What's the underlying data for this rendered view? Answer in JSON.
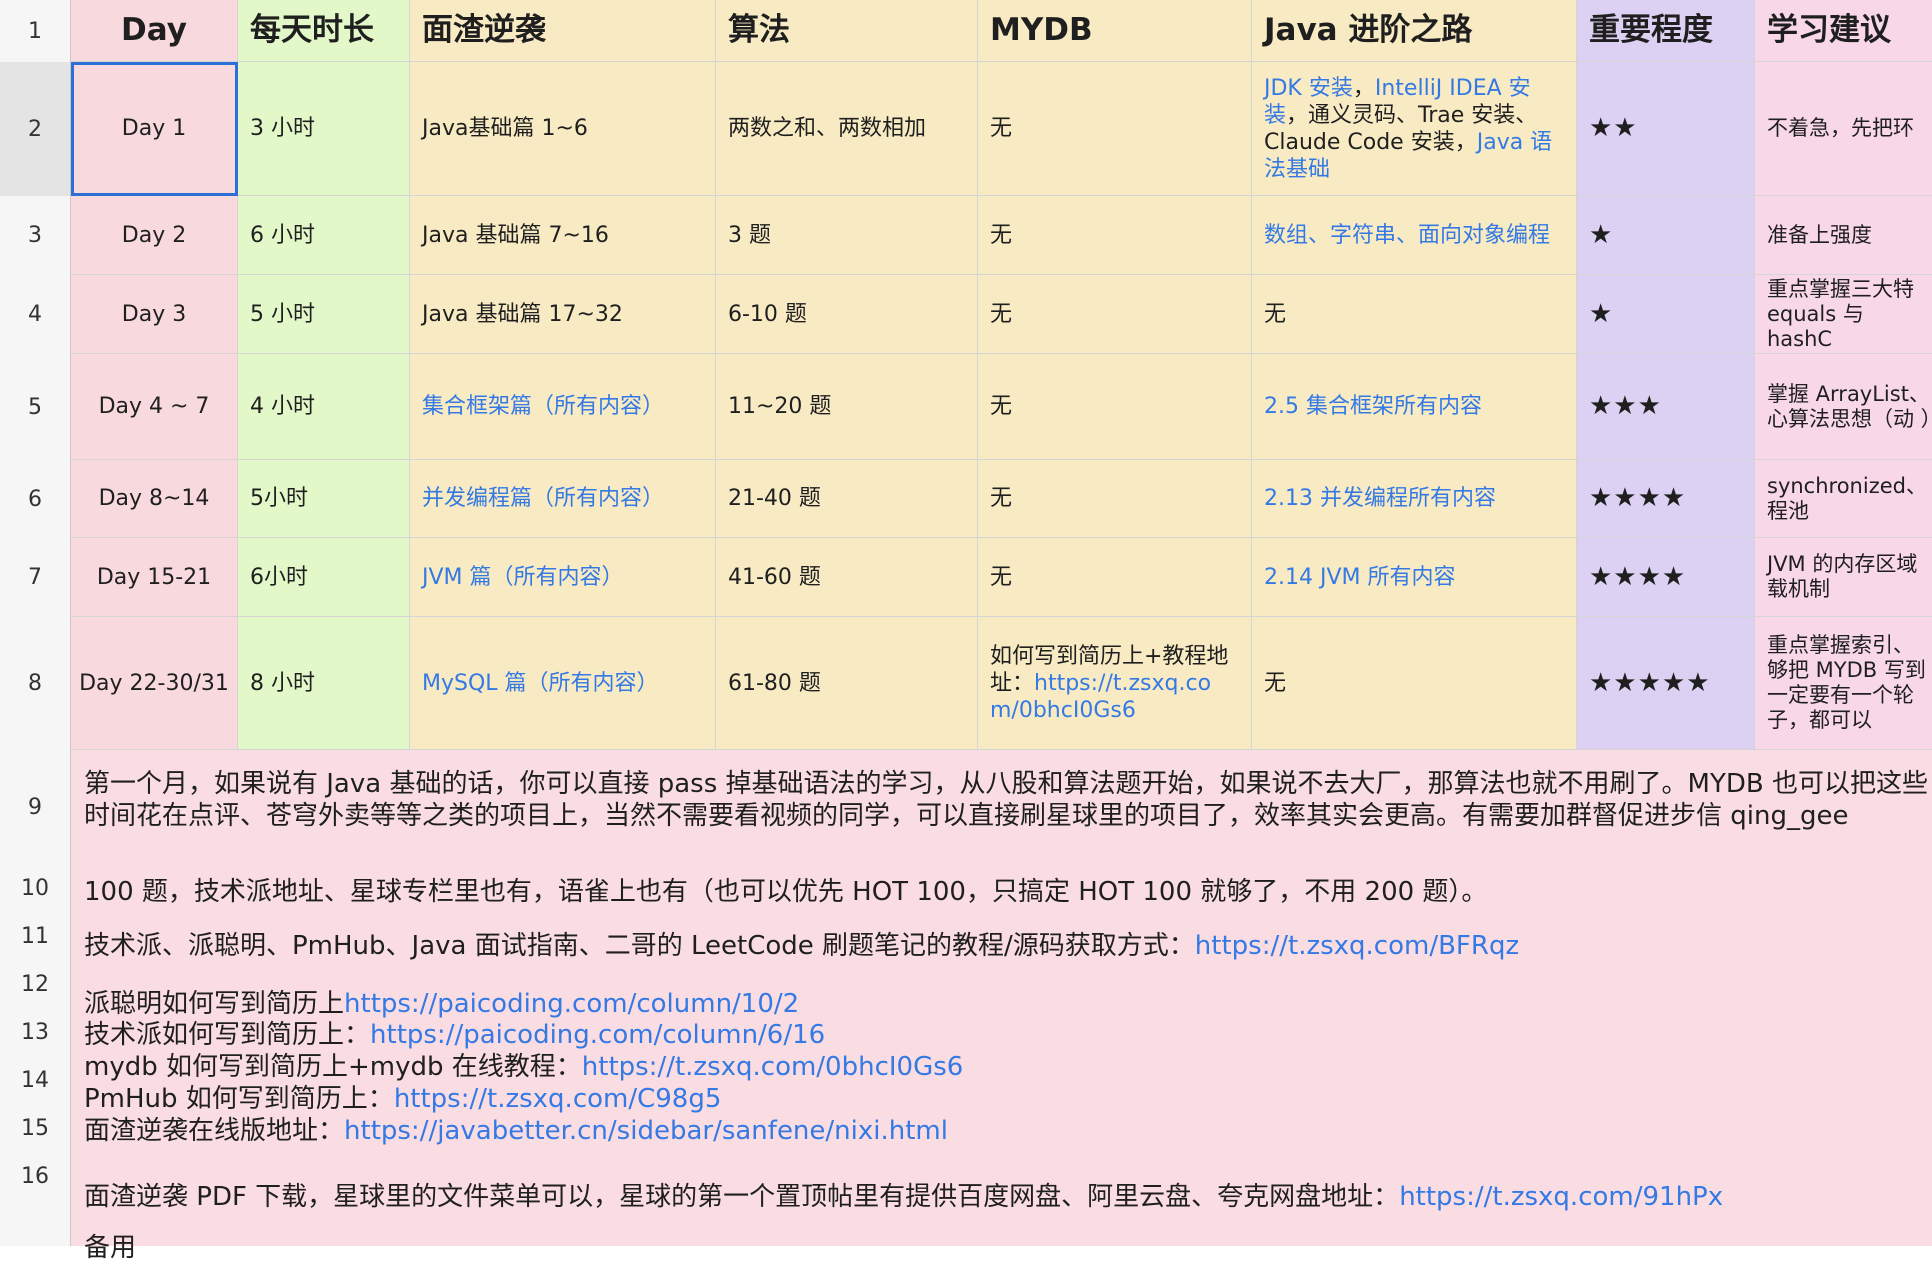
{
  "row_numbers": [
    "1",
    "2",
    "3",
    "4",
    "5",
    "6",
    "7",
    "8",
    "9",
    "10",
    "11",
    "12",
    "13",
    "14",
    "15",
    "16"
  ],
  "headers": [
    "Day",
    "每天时长",
    "面渣逆袭",
    "算法",
    "MYDB",
    "Java 进阶之路",
    "重要程度",
    "学习建议"
  ],
  "rows": [
    {
      "day": "Day 1",
      "hours": "3 小时",
      "mianzha": "Java基础篇 1~6",
      "algo": "两数之和、两数相加",
      "mydb": "无",
      "java_parts": [
        {
          "t": "JDK 安装",
          "link": true
        },
        {
          "t": "，",
          "link": false
        },
        {
          "t": "IntelliJ IDEA 安装",
          "link": true
        },
        {
          "t": "，通义灵码、Trae 安装、Claude Code 安装，",
          "link": false
        },
        {
          "t": "Java 语法基础",
          "link": true
        }
      ],
      "stars": "★★",
      "advice": "不着急，先把环"
    },
    {
      "day": "Day 2",
      "hours": "6 小时",
      "mianzha": "Java 基础篇 7~16",
      "algo": "3 题",
      "mydb": "无",
      "java_parts": [
        {
          "t": "数组、字符串、面向对象编程",
          "link": true
        }
      ],
      "stars": "★",
      "advice": "准备上强度"
    },
    {
      "day": "Day 3",
      "hours": "5 小时",
      "mianzha": "Java 基础篇 17~32",
      "algo": "6-10 题",
      "mydb": "无",
      "java_parts": [
        {
          "t": "无",
          "link": false
        }
      ],
      "stars": "★",
      "advice": "重点掌握三大特 equals 与 hashC"
    },
    {
      "day": "Day 4 ~ 7",
      "hours": "4 小时",
      "mianzha": "集合框架篇（所有内容）",
      "mianzha_link": true,
      "algo": "11~20 题",
      "mydb": "无",
      "java_parts": [
        {
          "t": "2.5 集合框架所有内容",
          "link": true
        }
      ],
      "stars": "★★★",
      "advice": "掌握 ArrayList、心算法思想（动 ）"
    },
    {
      "day": "Day 8~14",
      "hours": "5小时",
      "mianzha": "并发编程篇（所有内容）",
      "mianzha_link": true,
      "algo": "21-40 题",
      "mydb": "无",
      "java_parts": [
        {
          "t": "2.13 并发编程所有内容",
          "link": true
        }
      ],
      "stars": "★★★★",
      "advice": "synchronized、程池"
    },
    {
      "day": "Day 15-21",
      "hours": "6小时",
      "mianzha": "JVM 篇（所有内容）",
      "mianzha_link": true,
      "algo": "41-60 题",
      "mydb": "无",
      "java_parts": [
        {
          "t": "2.14 JVM 所有内容",
          "link": true
        }
      ],
      "stars": "★★★★",
      "advice": "JVM 的内存区域 载机制"
    },
    {
      "day": "Day 22-30/31",
      "hours": "8 小时",
      "mianzha": "MySQL 篇（所有内容）",
      "mianzha_link": true,
      "algo": "61-80 题",
      "mydb": "如何写到简历上+教程地址：",
      "mydb_link": "https://t.zsxq.com/0bhcI0Gs6",
      "java_parts": [
        {
          "t": "无",
          "link": false
        }
      ],
      "stars": "★★★★★",
      "advice": "重点掌握索引、够把 MYDB 写到 一定要有一个轮 子，都可以"
    }
  ],
  "notes": {
    "row9": "第一个月，如果说有 Java 基础的话，你可以直接 pass 掉基础语法的学习，从八股和算法题开始，如果说不去大厂，那算法也就不用刷了。MYDB 也可以把这些时间花在点评、苍穹外卖等等之类的项目上，当然不需要看视频的同学，可以直接刷星球里的项目了，效率其实会更高。有需要加群督促进步信 qing_gee",
    "row10": " 100 题，技术派地址、星球专栏里也有，语雀上也有（也可以优先 HOT 100，只搞定 HOT 100 就够了，不用 200 题）。",
    "row11_text": "技术派、派聪明、PmHub、Java 面试指南、二哥的 LeetCode 刷题笔记的教程/源码获取方式：",
    "row11_link": "https://t.zsxq.com/BFRqz",
    "row12_text": "派聪明如何写到简历上",
    "row12_link": "https://paicoding.com/column/10/2",
    "row13_text": "技术派如何写到简历上：",
    "row13_link": "https://paicoding.com/column/6/16",
    "row14_text": "mydb 如何写到简历上+mydb 在线教程：",
    "row14_link": "https://t.zsxq.com/0bhcI0Gs6",
    "row15_text": "PmHub 如何写到简历上：",
    "row15_link": "https://t.zsxq.com/C98g5",
    "row16_text": "面渣逆袭在线版地址：",
    "row16_link": "https://javabetter.cn/sidebar/sanfene/nixi.html",
    "row17_text": "面渣逆袭 PDF 下载，星球里的文件菜单可以，星球的第一个置顶帖里有提供百度网盘、阿里云盘、夸克网盘地址：",
    "row17_link": "https://t.zsxq.com/91hPx",
    "row18_text": "备用"
  },
  "colors": {
    "day": "#f8dade",
    "hours": "#e3f8c9",
    "yellow": "#f8ebc4",
    "purple": "#dcd0f3",
    "pink": "#f8d7e8",
    "notes": "#f9dde2",
    "link": "#3479e4",
    "selection": "#2c6fd6"
  }
}
